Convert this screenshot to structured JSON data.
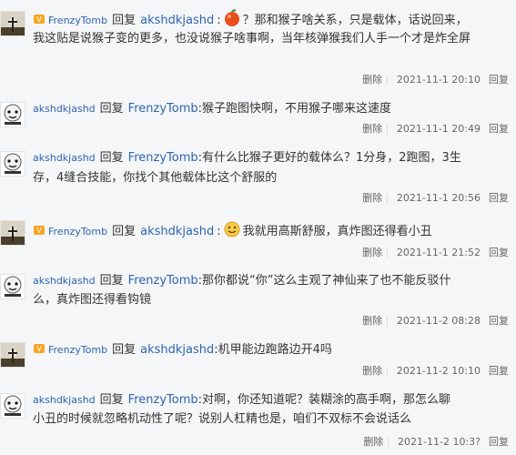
{
  "reply_word": "回复",
  "delete_label": "删除",
  "separator": "|",
  "reply_label": "回复",
  "comments": [
    {
      "author": "FrenzyTomb",
      "target": "akshdkjashd",
      "text_line1": "？那和猴子啥关系，只是载体，话说回来，",
      "text_rest": "我这贴是说猴子变的更多，也没说猴子啥事啊，当年核弹猴我们人手一个才是炸全屏",
      "time": "2021-11-1 20:10"
    },
    {
      "author": "akshdkjashd",
      "target": "FrenzyTomb",
      "text_line1": ":猴子跑图快啊，不用猴子哪来这速度",
      "text_rest": "",
      "time": "2021-11-1 20:49"
    },
    {
      "author": "akshdkjashd",
      "target": "FrenzyTomb",
      "text_line1": ":有什么比猴子更好的载体么？1分身，2跑图，3生",
      "text_rest": "存，4缝合技能，你找个其他载体比这个舒服的",
      "time": "2021-11-1 20:56"
    },
    {
      "author": "FrenzyTomb",
      "target": "akshdkjashd",
      "text_line1": "我就用高斯舒服，真炸图还得看小丑",
      "text_rest": "",
      "time": "2021-11-1 21:52"
    },
    {
      "author": "akshdkjashd",
      "target": "FrenzyTomb",
      "text_line1": ":那你都说“你”这么主观了神仙来了也不能反驳什",
      "text_rest": "么，真炸图还得看钩镜",
      "time": "2021-11-2 08:28"
    },
    {
      "author": "FrenzyTomb",
      "target": "akshdkjashd",
      "text_line1": ":机甲能边跑路边开4吗",
      "text_rest": "",
      "time": "2021-11-2 10:10"
    },
    {
      "author": "akshdkjashd",
      "target": "FrenzyTomb",
      "text_line1": ":对啊，你还知道呢？装糊涂的高手啊，那怎么聊",
      "text_rest": "小丑的时候就忽略机动性了呢？说别人杠精也是，咱们不双标不会说话么",
      "time": "2021-11-2 10:3?"
    }
  ]
}
